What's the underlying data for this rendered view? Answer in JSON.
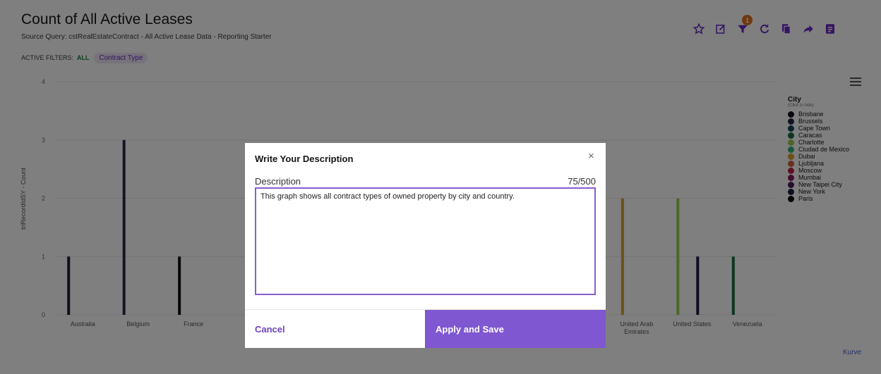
{
  "header": {
    "title": "Count of All Active Leases",
    "source_query": "Source Query: cstRealEstateContract - All Active Lease Data - Reporting Starter",
    "filters_label": "ACTIVE FILTERS:",
    "filters_all": "ALL",
    "filter_chip": "Contract Type"
  },
  "toolbar": {
    "icons": [
      "star-icon",
      "edit-icon",
      "filter-icon",
      "refresh-icon",
      "copy-icon",
      "share-icon",
      "document-icon"
    ],
    "filter_badge": "1",
    "accent": "#6929c4"
  },
  "chart_data": {
    "type": "bar",
    "ylabel": "triRecordIdSY - Count",
    "ylim": [
      0,
      4
    ],
    "yticks": [
      "0",
      "1",
      "2",
      "3",
      "4"
    ],
    "categories": [
      "Australia",
      "Belgium",
      "France",
      "",
      "",
      "",
      "",
      "",
      "",
      "",
      "United Arab Emirates",
      "United States",
      "Venezuela"
    ],
    "visible_category_labels": [
      {
        "label": "Australia"
      },
      {
        "label": "Belgium"
      },
      {
        "label": "France"
      },
      {
        "label": "United Arab\nEmirates"
      },
      {
        "label": "United States"
      },
      {
        "label": "Venezuela"
      }
    ],
    "bars": [
      {
        "category": "Australia",
        "city": "Paris",
        "value": 1,
        "color": "#1c1c3c"
      },
      {
        "category": "Belgium",
        "city": "Brussels",
        "value": 3,
        "color": "#2a2a50"
      },
      {
        "category": "France",
        "city": "Paris",
        "value": 1,
        "color": "#111111"
      },
      {
        "category": "United Arab Emirates",
        "city": "Dubai",
        "value": 2,
        "color": "#d9a030"
      },
      {
        "category": "United States",
        "city": "Charlotte",
        "value": 2,
        "color": "#9acd50"
      },
      {
        "category": "United States",
        "city": "New York",
        "value": 1,
        "color": "#1a1a40"
      },
      {
        "category": "Venezuela",
        "city": "Caracas",
        "value": 1,
        "color": "#1a6a40"
      }
    ],
    "legend_position": "right",
    "grid": true
  },
  "legend": {
    "title": "City",
    "subtitle": "(Click to hide)",
    "items": [
      {
        "label": "Brisbane",
        "color": "#111122"
      },
      {
        "label": "Brussels",
        "color": "#262a4a"
      },
      {
        "label": "Cape Town",
        "color": "#124a55"
      },
      {
        "label": "Caracas",
        "color": "#1a6a40"
      },
      {
        "label": "Charlotte",
        "color": "#9acd50"
      },
      {
        "label": "Ciudad de Mexico",
        "color": "#2fb07a"
      },
      {
        "label": "Dubai",
        "color": "#d9a030"
      },
      {
        "label": "Ljubljana",
        "color": "#d0603a"
      },
      {
        "label": "Moscow",
        "color": "#c0204a"
      },
      {
        "label": "Mumbai",
        "color": "#8a1a5a"
      },
      {
        "label": "New Taipei City",
        "color": "#4a1a5a"
      },
      {
        "label": "New York",
        "color": "#1a1a40"
      },
      {
        "label": "Paris",
        "color": "#0a0a0a"
      }
    ]
  },
  "footer": {
    "brand": "Kurve"
  },
  "modal": {
    "title": "Write Your Description",
    "close": "×",
    "label": "Description",
    "count": "75/500",
    "text": "This graph shows all contract types of owned property by city and country.",
    "cancel": "Cancel",
    "apply": "Apply and Save"
  }
}
